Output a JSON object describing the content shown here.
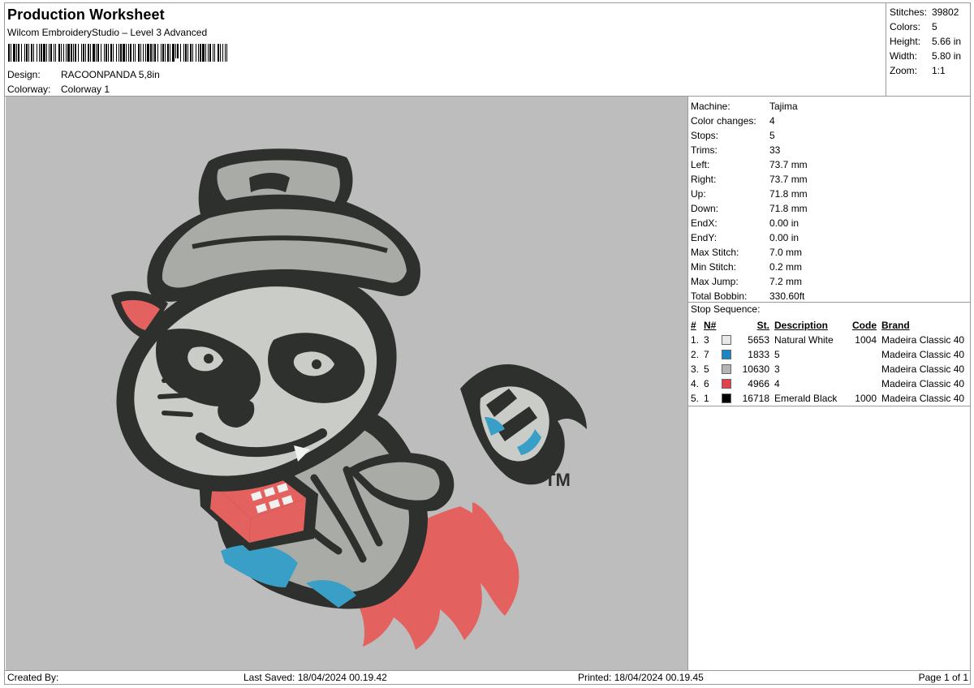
{
  "header": {
    "title": "Production Worksheet",
    "software": "Wilcom EmbroideryStudio – Level 3 Advanced",
    "design_label": "Design:",
    "design_value": "RACOONPANDA 5,8in",
    "colorway_label": "Colorway:",
    "colorway_value": "Colorway 1"
  },
  "stats": [
    {
      "label": "Stitches:",
      "value": "39802"
    },
    {
      "label": "Colors:",
      "value": "5"
    },
    {
      "label": "Height:",
      "value": "5.66 in"
    },
    {
      "label": "Width:",
      "value": "5.80 in"
    },
    {
      "label": "Zoom:",
      "value": "1:1"
    }
  ],
  "machine": [
    {
      "label": "Machine:",
      "value": "Tajima"
    },
    {
      "label": "Color changes:",
      "value": "4"
    },
    {
      "label": "Stops:",
      "value": "5"
    },
    {
      "label": "Trims:",
      "value": "33"
    },
    {
      "label": "Left:",
      "value": "73.7 mm"
    },
    {
      "label": "Right:",
      "value": "73.7 mm"
    },
    {
      "label": "Up:",
      "value": "71.8 mm"
    },
    {
      "label": "Down:",
      "value": "71.8 mm"
    },
    {
      "label": "EndX:",
      "value": "0.00 in"
    },
    {
      "label": "EndY:",
      "value": "0.00 in"
    },
    {
      "label": "Max Stitch:",
      "value": "7.0 mm"
    },
    {
      "label": "Min Stitch:",
      "value": "0.2 mm"
    },
    {
      "label": "Max Jump:",
      "value": "7.2 mm"
    },
    {
      "label": "Total Bobbin:",
      "value": "330.60ft"
    }
  ],
  "stop_sequence": {
    "title": "Stop Sequence:",
    "columns": {
      "num": "#",
      "n": "N#",
      "st": "St.",
      "desc": "Description",
      "code": "Code",
      "brand": "Brand"
    },
    "rows": [
      {
        "num": "1.",
        "n": "3",
        "color": "#e8e8e8",
        "st": "5653",
        "desc": "Natural White",
        "code": "1004",
        "brand": "Madeira Classic 40"
      },
      {
        "num": "2.",
        "n": "7",
        "color": "#1b86c4",
        "st": "1833",
        "desc": "5",
        "code": "",
        "brand": "Madeira Classic 40"
      },
      {
        "num": "3.",
        "n": "5",
        "color": "#b4b4b4",
        "st": "10630",
        "desc": "3",
        "code": "",
        "brand": "Madeira Classic 40"
      },
      {
        "num": "4.",
        "n": "6",
        "color": "#e0434b",
        "st": "4966",
        "desc": "4",
        "code": "",
        "brand": "Madeira Classic 40"
      },
      {
        "num": "5.",
        "n": "1",
        "color": "#000000",
        "st": "16718",
        "desc": "Emerald Black",
        "code": "1000",
        "brand": "Madeira Classic 40"
      }
    ]
  },
  "preview": {
    "background": "#bdbdbd",
    "trademark": "TM",
    "colors": {
      "outline": "#2e302e",
      "body": "#a8aba6",
      "light": "#c9ccc7",
      "red": "#e3625f",
      "blue": "#3a9fc6",
      "white": "#f1f1ef"
    }
  },
  "footer": {
    "created_by": "Created By:",
    "last_saved": "Last Saved: 18/04/2024 00.19.42",
    "printed": "Printed: 18/04/2024 00.19.45",
    "page": "Page 1 of 1"
  }
}
